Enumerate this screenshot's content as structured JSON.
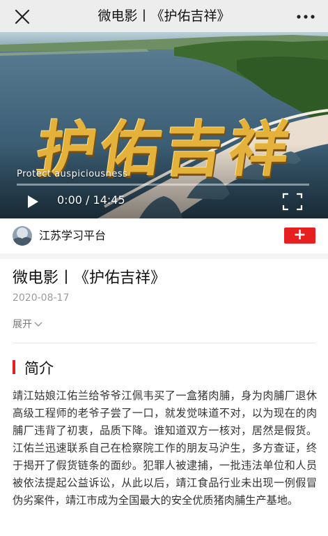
{
  "topbar": {
    "title": "微电影丨《护佑吉祥》",
    "close_icon": "close-icon",
    "more_icon": "more-dots-icon"
  },
  "video": {
    "title_overlay": "护佑吉祥",
    "subtitle_overlay": "Protect auspiciousness",
    "current_time": "0:00",
    "time_separator": "/",
    "duration": "14:45",
    "progress_fraction": 0,
    "play_icon": "play-icon",
    "fullscreen_icon": "fullscreen-icon",
    "accent_color": "#e4b13a"
  },
  "account": {
    "name": "江苏学习平台",
    "follow_label": "+",
    "follow_color": "#e42120"
  },
  "article": {
    "title": "微电影丨《护佑吉祥》",
    "date": "2020-08-17",
    "expand_label": "展开",
    "section_title": "简介",
    "description": "靖江姑娘江佑兰给爷爷江佩韦买了一盒猪肉脯，身为肉脯厂退休高级工程师的老爷子尝了一口，就发觉味道不对，以为现在的肉脯厂违背了初衷，品质下降。谁知道双方一核对，居然是假货。江佑兰迅速联系自己在检察院工作的朋友马沪生，多方查证，终于揭开了假货链条的面纱。犯罪人被逮捕，一批违法单位和人员被依法提起公益诉讼，从此以后，靖江食品行业未出现一例假冒伪劣案件，靖江市成为全国最大的安全优质猪肉脯生产基地。"
  }
}
